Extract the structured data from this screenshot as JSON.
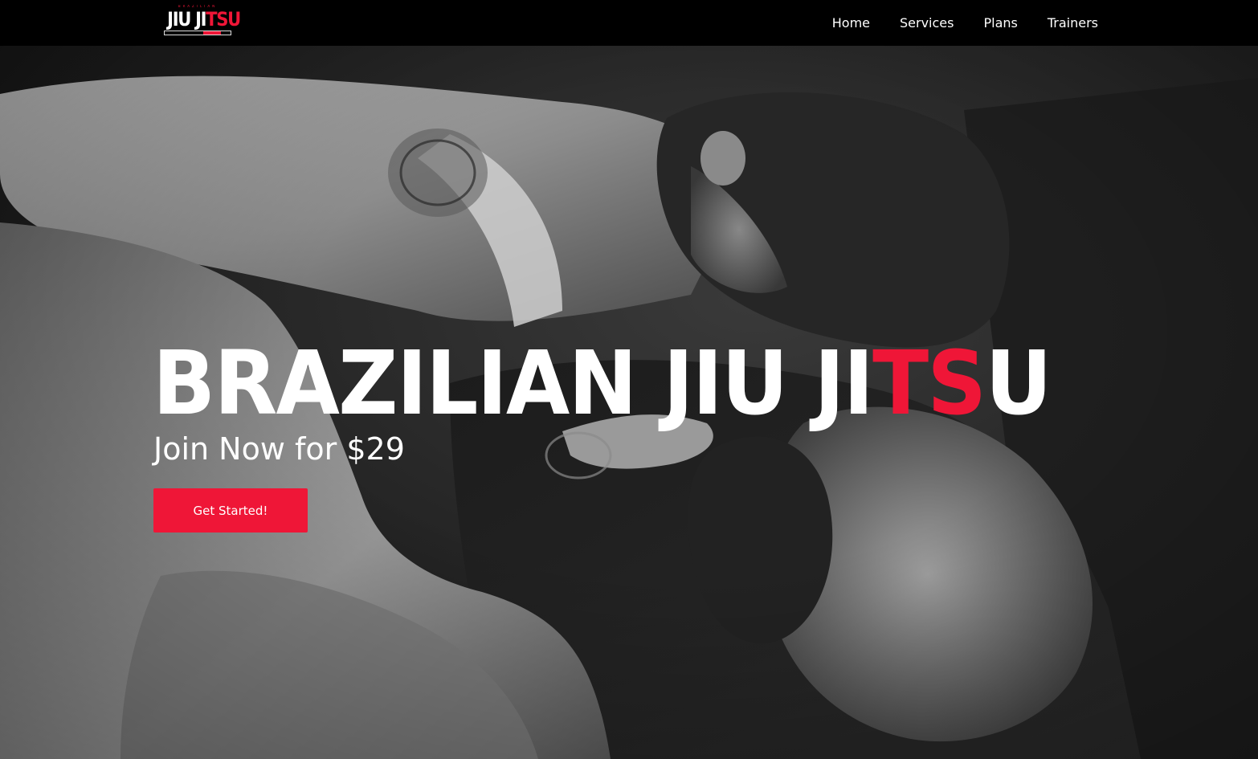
{
  "nav": {
    "logo": {
      "top_text": "BRAZILIAN",
      "main_white": "JIU JI",
      "main_red": "TSU"
    },
    "links": [
      {
        "label": "Home"
      },
      {
        "label": "Services"
      },
      {
        "label": "Plans"
      },
      {
        "label": "Trainers"
      }
    ]
  },
  "hero": {
    "title_white": "BRAZILIAN JIU JI",
    "title_red": "TS",
    "title_end": "U",
    "subtitle": "Join Now for $29",
    "cta_label": "Get Started!"
  },
  "colors": {
    "accent": "#ef1637",
    "navbar_bg": "#000000",
    "text": "#ffffff"
  }
}
